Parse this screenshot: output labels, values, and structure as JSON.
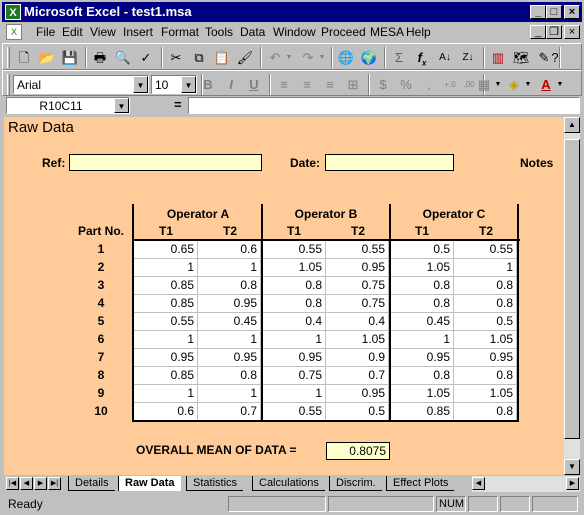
{
  "window": {
    "title": "Microsoft Excel - test1.msa",
    "controls": {
      "minimize": "_",
      "maximize": "□",
      "close": "×"
    }
  },
  "menu": [
    "File",
    "Edit",
    "View",
    "Insert",
    "Format",
    "Tools",
    "Data",
    "Window",
    "Proceed",
    "MESA",
    "Help"
  ],
  "mdi_controls": {
    "minimize": "_",
    "restore": "❐",
    "close": "×"
  },
  "formatting": {
    "font": "Arial",
    "size": "10"
  },
  "formula_bar": {
    "name_box": "R10C11",
    "eq": "=",
    "value": ""
  },
  "sheet": {
    "title": "Raw Data",
    "ref_label": "Ref:",
    "date_label": "Date:",
    "notes_label": "Notes",
    "operators": [
      "Operator A",
      "Operator B",
      "Operator C"
    ],
    "part_no_header": "Part No.",
    "trials": [
      "T1",
      "T2",
      "T1",
      "T2",
      "T1",
      "T2"
    ],
    "rows": [
      {
        "part": "1",
        "values": [
          "0.65",
          "0.6",
          "0.55",
          "0.55",
          "0.5",
          "0.55"
        ]
      },
      {
        "part": "2",
        "values": [
          "1",
          "1",
          "1.05",
          "0.95",
          "1.05",
          "1"
        ]
      },
      {
        "part": "3",
        "values": [
          "0.85",
          "0.8",
          "0.8",
          "0.75",
          "0.8",
          "0.8"
        ]
      },
      {
        "part": "4",
        "values": [
          "0.85",
          "0.95",
          "0.8",
          "0.75",
          "0.8",
          "0.8"
        ]
      },
      {
        "part": "5",
        "values": [
          "0.55",
          "0.45",
          "0.4",
          "0.4",
          "0.45",
          "0.5"
        ]
      },
      {
        "part": "6",
        "values": [
          "1",
          "1",
          "1",
          "1.05",
          "1",
          "1.05"
        ]
      },
      {
        "part": "7",
        "values": [
          "0.95",
          "0.95",
          "0.95",
          "0.9",
          "0.95",
          "0.95"
        ]
      },
      {
        "part": "8",
        "values": [
          "0.85",
          "0.8",
          "0.75",
          "0.7",
          "0.8",
          "0.8"
        ]
      },
      {
        "part": "9",
        "values": [
          "1",
          "1",
          "1",
          "0.95",
          "1.05",
          "1.05"
        ]
      },
      {
        "part": "10",
        "values": [
          "0.6",
          "0.7",
          "0.55",
          "0.5",
          "0.85",
          "0.8"
        ]
      }
    ],
    "mean_label": "OVERALL MEAN OF DATA =",
    "mean_value": "0.8075"
  },
  "tabs": [
    {
      "label": "Details"
    },
    {
      "label": "Raw Data",
      "active": true
    },
    {
      "label": "Statistics"
    },
    {
      "label": "Calculations"
    },
    {
      "label": "Discrim."
    },
    {
      "label": "Effect Plots"
    }
  ],
  "status": {
    "text": "Ready",
    "num": "NUM"
  },
  "colors": {
    "title_bar": "#000080",
    "sheet_bg": "#ffcc99",
    "input_fill": "#ffffcc",
    "chrome": "#c0c0c0"
  }
}
